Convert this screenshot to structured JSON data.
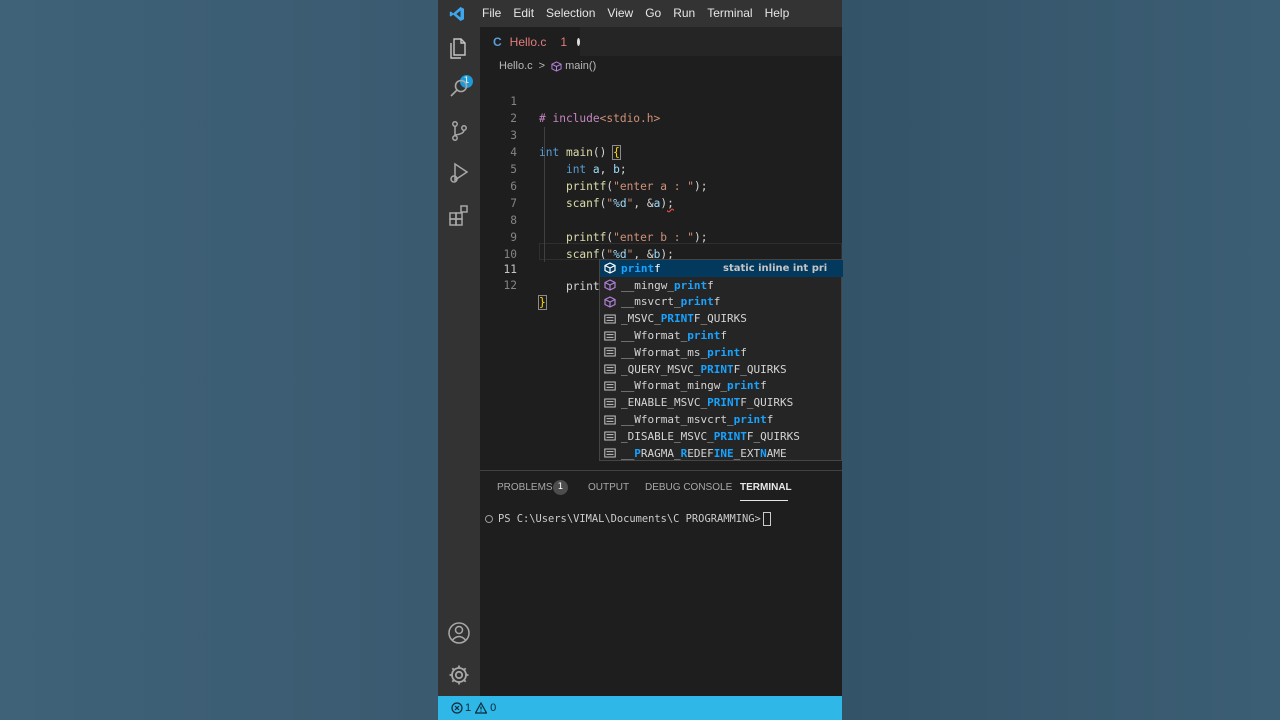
{
  "menu": [
    "File",
    "Edit",
    "Selection",
    "View",
    "Go",
    "Run",
    "Terminal",
    "Help"
  ],
  "activity": {
    "explorer_badge": "1",
    "icons": [
      "files-icon",
      "search-icon",
      "source-control-icon",
      "run-debug-icon",
      "extensions-icon",
      "account-icon",
      "settings-gear-icon"
    ]
  },
  "tab": {
    "lang_letter": "C",
    "file_name": "Hello.c",
    "problem_count": "1"
  },
  "breadcrumb": {
    "file": "Hello.c",
    "separator": ">",
    "symbol": "main()"
  },
  "editor": {
    "line_numbers": [
      "1",
      "2",
      "3",
      "4",
      "5",
      "6",
      "7",
      "8",
      "9",
      "10",
      "11",
      "12"
    ],
    "current_line": "11",
    "lines": [
      "# include<stdio.h>",
      "",
      "int main() {",
      "    int a, b;",
      "    printf(\"enter a : \");",
      "    scanf(\"%d\", &a);",
      "",
      "    printf(\"enter b : \");",
      "    scanf(\"%d\", &b);",
      "",
      "    print",
      "}"
    ]
  },
  "suggestions": {
    "selected_detail": "static inline int pri",
    "items": [
      {
        "pre": "",
        "match": "print",
        "post": "f",
        "kind": "function"
      },
      {
        "pre": "__mingw_",
        "match": "print",
        "post": "f",
        "kind": "function"
      },
      {
        "pre": "__msvcrt_",
        "match": "print",
        "post": "f",
        "kind": "function"
      },
      {
        "pre": "_MSVC_",
        "match": "PRINT",
        "post": "F_QUIRKS",
        "kind": "text"
      },
      {
        "pre": "__Wformat_",
        "match": "print",
        "post": "f",
        "kind": "text"
      },
      {
        "pre": "__Wformat_ms_",
        "match": "print",
        "post": "f",
        "kind": "text"
      },
      {
        "pre": "_QUERY_MSVC_",
        "match": "PRINT",
        "post": "F_QUIRKS",
        "kind": "text"
      },
      {
        "pre": "__Wformat_mingw_",
        "match": "print",
        "post": "f",
        "kind": "text"
      },
      {
        "pre": "_ENABLE_MSVC_",
        "match": "PRINT",
        "post": "F_QUIRKS",
        "kind": "text"
      },
      {
        "pre": "__Wformat_msvcrt_",
        "match": "print",
        "post": "f",
        "kind": "text"
      },
      {
        "pre": "_DISABLE_MSVC_",
        "match": "PRINT",
        "post": "F_QUIRKS",
        "kind": "text"
      },
      {
        "pre": "__",
        "match": "P",
        "post": "RAGMA_",
        "match2": "R",
        "post2": "EDEF",
        "match3": "INE",
        "post3": "_EXT",
        "match4": "N",
        "post4": "AME",
        "kind": "text"
      }
    ]
  },
  "panel": {
    "tabs": [
      "PROBLEMS",
      "OUTPUT",
      "DEBUG CONSOLE",
      "TERMINAL"
    ],
    "active_tab": "TERMINAL",
    "problems_badge": "1",
    "terminal_prompt": "PS C:\\Users\\VIMAL\\Documents\\C PROGRAMMING>"
  },
  "status": {
    "errors": "1",
    "warnings": "0"
  },
  "colors": {
    "statusbar": "#2fb7e8",
    "match_highlight": "#18a3ff",
    "tab_error": "#e27c7c"
  }
}
